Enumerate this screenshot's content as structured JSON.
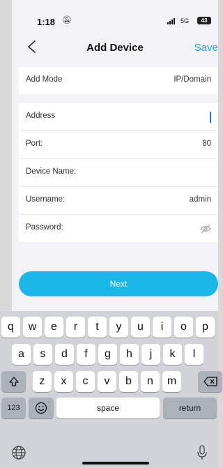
{
  "status_bar": {
    "time": "1:18",
    "network": "5G",
    "battery": "43"
  },
  "nav": {
    "title": "Add Device",
    "save_label": "Save"
  },
  "form": {
    "add_mode": {
      "label": "Add Mode",
      "value": "IP/Domain"
    },
    "address": {
      "label": "Address",
      "value": ""
    },
    "port": {
      "label": "Port:",
      "value": "80"
    },
    "device_name": {
      "label": "Device Name:",
      "value": ""
    },
    "username": {
      "label": "Username:",
      "value": "admin"
    },
    "password": {
      "label": "Password:",
      "value": ""
    }
  },
  "next_label": "Next",
  "keyboard": {
    "row1": [
      "q",
      "w",
      "e",
      "r",
      "t",
      "y",
      "u",
      "i",
      "o",
      "p"
    ],
    "row2": [
      "a",
      "s",
      "d",
      "f",
      "g",
      "h",
      "j",
      "k",
      "l"
    ],
    "row3": [
      "z",
      "x",
      "c",
      "v",
      "b",
      "n",
      "m"
    ],
    "numbers_label": "123",
    "space_label": "space",
    "return_label": "return"
  },
  "colors": {
    "accent": "#19b7e8",
    "save": "#2aa6d9",
    "background": "#f2f2f7"
  }
}
